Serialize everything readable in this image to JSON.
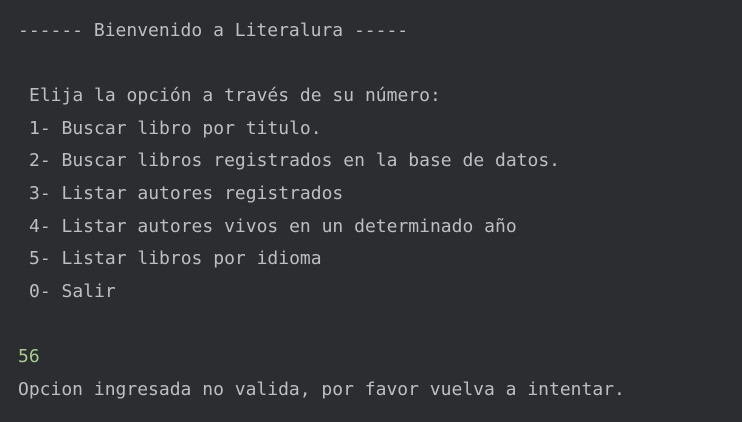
{
  "console": {
    "header": "------ Bienvenido a Literalura -----",
    "prompt": "Elija la opción a través de su número:",
    "menu": [
      "1- Buscar libro por titulo.",
      "2- Buscar libros registrados en la base de datos.",
      "3- Listar autores registrados",
      "4- Listar autores vivos en un determinado año",
      "5- Listar libros por idioma",
      "0- Salir"
    ],
    "user_input": "56",
    "error_message": "Opcion ingresada no valida, por favor vuelva a intentar."
  },
  "colors": {
    "background": "#2b2d30",
    "text": "#bcbec4",
    "user_input": "#a9c98e"
  }
}
